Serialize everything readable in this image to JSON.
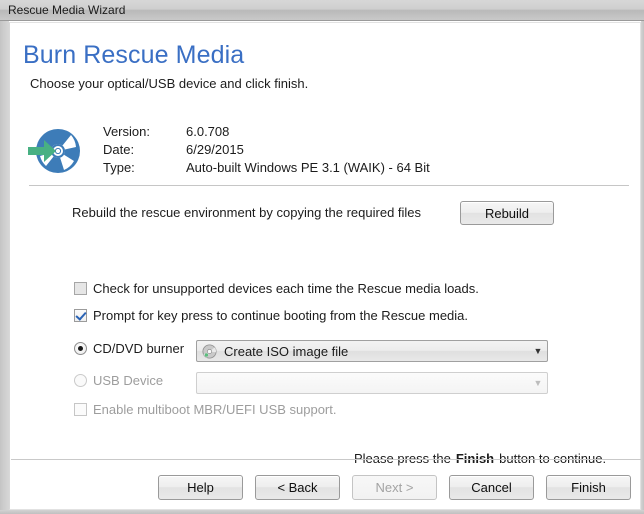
{
  "window": {
    "title": "Rescue Media Wizard"
  },
  "header": {
    "heading": "Burn Rescue Media",
    "subheading": "Choose your optical/USB device and click finish.",
    "heading_color": "#3a6fc4"
  },
  "media_info": {
    "icon": "cd-disc-import-icon",
    "icon_colors": {
      "disc": "#3d7cb8",
      "arrow": "#48b083"
    },
    "rows": [
      {
        "label": "Version:",
        "value": "6.0.708"
      },
      {
        "label": "Date:",
        "value": "6/29/2015"
      },
      {
        "label": "Type:",
        "value": "Auto-built Windows PE 3.1 (WAIK) - 64 Bit"
      }
    ]
  },
  "rebuild": {
    "description": "Rebuild the rescue environment by copying the required files",
    "button_label": "Rebuild",
    "button_enabled": true
  },
  "options": {
    "check_unsupported": {
      "label": "Check for unsupported devices each time the Rescue media loads.",
      "checked": false,
      "enabled": true
    },
    "prompt_key_press": {
      "label": "Prompt for key press to continue booting from the Rescue media.",
      "checked": true,
      "enabled": true
    },
    "enable_multiboot": {
      "label": "Enable multiboot MBR/UEFI USB support.",
      "checked": false,
      "enabled": false
    }
  },
  "targets": {
    "cddvd": {
      "radio_label": "CD/DVD burner",
      "selected": true,
      "enabled": true,
      "combo_icon": "optical-disc-icon",
      "combo_value": "Create ISO image file",
      "combo_enabled": true,
      "combo_arrow": "▼"
    },
    "usb": {
      "radio_label": "USB Device",
      "selected": false,
      "enabled": false,
      "combo_value": "",
      "combo_enabled": false,
      "combo_arrow": "▼"
    }
  },
  "footer": {
    "note_prefix": "Please press the",
    "note_accent": "Finish",
    "note_suffix": "button to continue.",
    "buttons": [
      {
        "label": "Help",
        "enabled": true
      },
      {
        "label": "< Back",
        "enabled": true
      },
      {
        "label": "Next >",
        "enabled": false
      },
      {
        "label": "Cancel",
        "enabled": true
      },
      {
        "label": "Finish",
        "enabled": true
      }
    ]
  }
}
